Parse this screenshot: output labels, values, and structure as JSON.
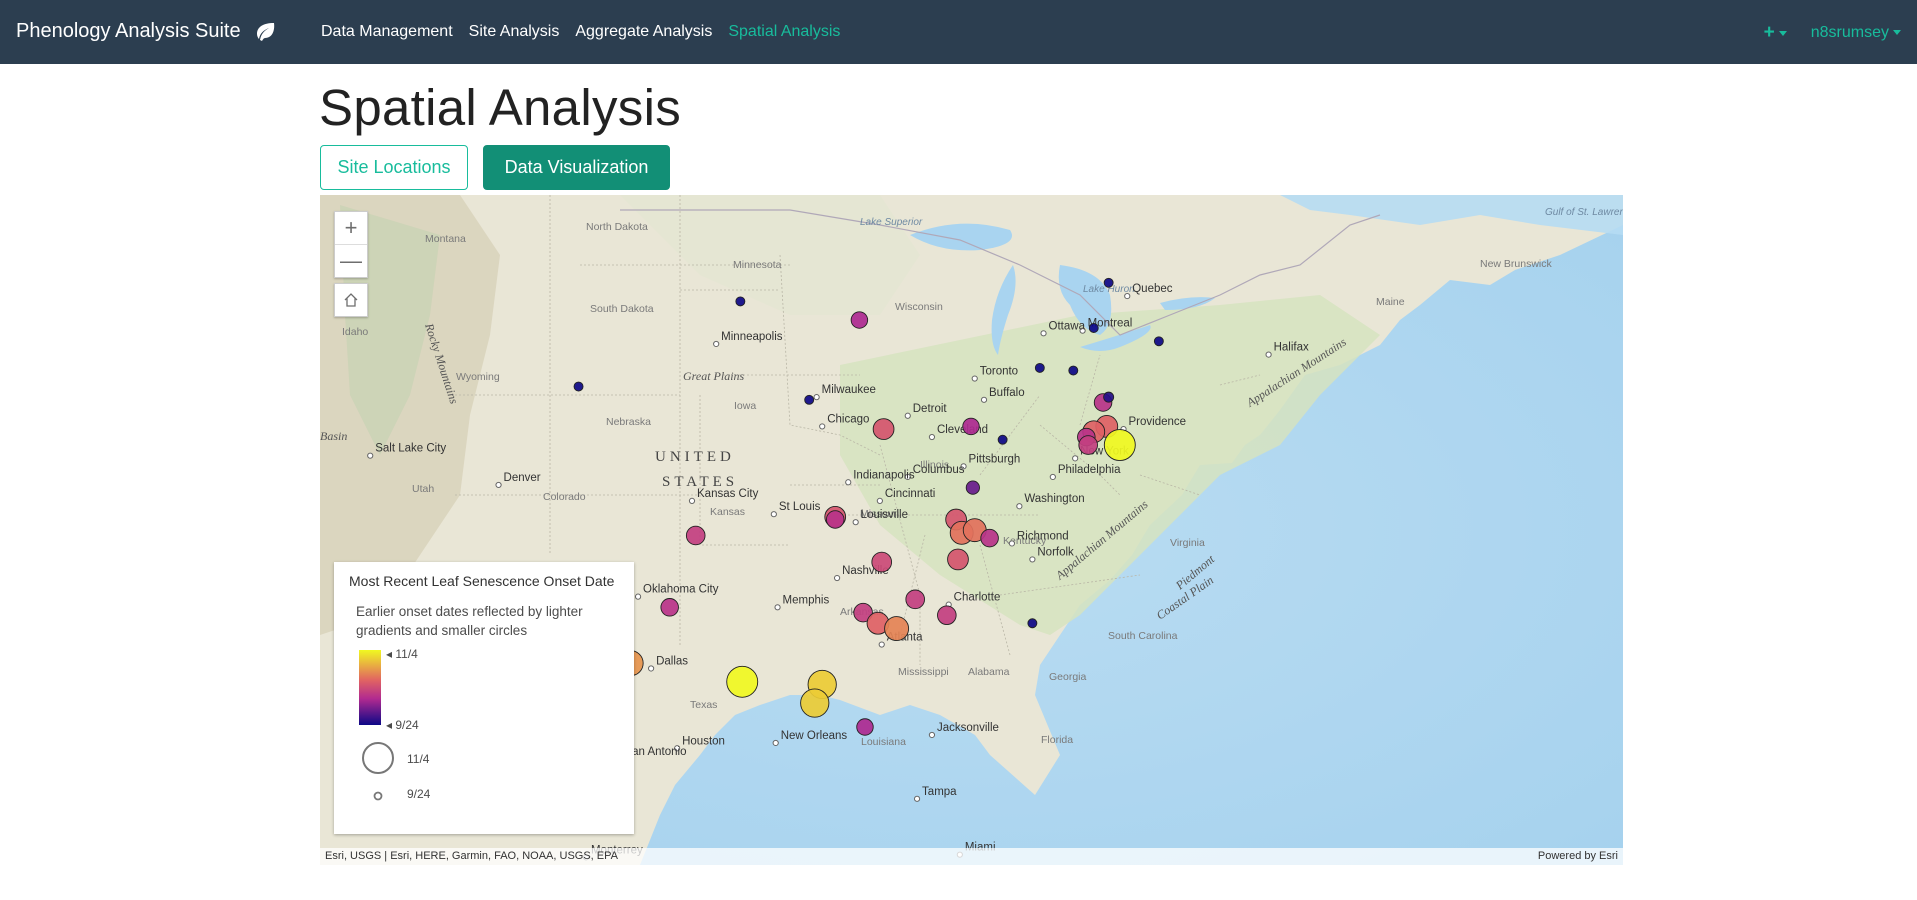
{
  "navbar": {
    "brand": "Phenology Analysis Suite",
    "brand_icon": "leaf-icon",
    "links": [
      {
        "label": "Data Management",
        "active": false
      },
      {
        "label": "Site Analysis",
        "active": false
      },
      {
        "label": "Aggregate Analysis",
        "active": false
      },
      {
        "label": "Spatial Analysis",
        "active": true
      }
    ],
    "add_label": "+",
    "user": "n8srumsey",
    "accent_color": "#18bc9c",
    "bar_color": "#2c3e50"
  },
  "page": {
    "title": "Spatial Analysis",
    "tabs": [
      {
        "label": "Site Locations",
        "selected": false
      },
      {
        "label": "Data Visualization",
        "selected": true
      }
    ]
  },
  "map": {
    "zoom_in": "+",
    "zoom_out": "—",
    "home_icon": "home-icon",
    "attribution_left": "Esri, USGS | Esri, HERE, Garmin, FAO, NOAA, USGS, EPA",
    "attribution_right": "Powered by Esri",
    "cities": [
      "Quebec",
      "Montreal",
      "Ottawa",
      "Halifax",
      "Toronto",
      "Buffalo",
      "Minneapolis",
      "Milwaukee",
      "Chicago",
      "Detroit",
      "Cleveland",
      "Pittsburgh",
      "New York",
      "Philadelphia",
      "Providence",
      "Washington",
      "Richmond",
      "Norfolk",
      "Columbus",
      "Indianapolis",
      "Cincinnati",
      "Louisville",
      "Kansas City",
      "St Louis",
      "Nashville",
      "Charlotte",
      "Atlanta",
      "Memphis",
      "Oklahoma City",
      "Dallas",
      "Houston",
      "San Antonio",
      "New Orleans",
      "Jacksonville",
      "Tampa",
      "Miami",
      "Denver",
      "Salt Lake City",
      "Monterrey"
    ],
    "regions": [
      "Montana",
      "North Dakota",
      "South Dakota",
      "Minnesota",
      "Wisconsin",
      "Iowa",
      "Nebraska",
      "Wyoming",
      "Idaho",
      "Utah",
      "Colorado",
      "Kansas",
      "Missouri",
      "Illinois",
      "Kentucky",
      "Arkansas",
      "Texas",
      "Mississippi",
      "Alabama",
      "Georgia",
      "Louisiana",
      "Florida",
      "Virginia",
      "South Carolina",
      "New Brunswick",
      "Maine",
      "Great Plains",
      "UNITED",
      "STATES",
      "Rocky Mountains",
      "Appalachian Mountains",
      "Appalachian Mountains",
      "Coastal Plain",
      "Lake Superior",
      "Lake Huron",
      "Gulf of St. Lawrence",
      "Piedmont",
      "Basin"
    ],
    "point_colors": {
      "early": "#2d0f6b",
      "mid": "#b03a7f",
      "late_mid": "#dc6a5a",
      "late": "#f2e530"
    }
  },
  "legend": {
    "title": "Most Recent Leaf Senescence Onset Date",
    "description": "Earlier onset dates reflected by lighter gradients and smaller circles",
    "color_max_label": "11/4",
    "color_min_label": "9/24",
    "size_max_label": "11/4",
    "size_min_label": "9/24"
  },
  "sites": [
    {
      "lon": -92.0,
      "lat": 46.6,
      "onset": "9/24"
    },
    {
      "lon": -85.6,
      "lat": 45.9,
      "onset": "10/8"
    },
    {
      "lon": -100.7,
      "lat": 43.4,
      "onset": "9/24"
    },
    {
      "lon": -88.3,
      "lat": 42.9,
      "onset": "9/24"
    },
    {
      "lon": -84.3,
      "lat": 41.8,
      "onset": "10/16"
    },
    {
      "lon": -79.6,
      "lat": 41.9,
      "onset": "10/8"
    },
    {
      "lon": -77.9,
      "lat": 41.4,
      "onset": "9/24"
    },
    {
      "lon": -74.1,
      "lat": 44.0,
      "onset": "9/24"
    },
    {
      "lon": -72.2,
      "lat": 47.3,
      "onset": "9/24"
    },
    {
      "lon": -73.0,
      "lat": 45.6,
      "onset": "9/24"
    },
    {
      "lon": -69.5,
      "lat": 45.1,
      "onset": "9/24"
    },
    {
      "lon": -75.9,
      "lat": 44.1,
      "onset": "9/24"
    },
    {
      "lon": -72.5,
      "lat": 42.8,
      "onset": "10/10"
    },
    {
      "lon": -72.2,
      "lat": 43.0,
      "onset": "9/26"
    },
    {
      "lon": -72.3,
      "lat": 41.9,
      "onset": "10/18"
    },
    {
      "lon": -73.0,
      "lat": 41.7,
      "onset": "10/18"
    },
    {
      "lon": -73.4,
      "lat": 41.5,
      "onset": "10/10"
    },
    {
      "lon": -71.6,
      "lat": 41.2,
      "onset": "11/4"
    },
    {
      "lon": -73.3,
      "lat": 41.2,
      "onset": "10/12"
    },
    {
      "lon": -79.5,
      "lat": 39.6,
      "onset": "10/2"
    },
    {
      "lon": -80.4,
      "lat": 38.4,
      "onset": "10/16"
    },
    {
      "lon": -80.1,
      "lat": 37.9,
      "onset": "10/20"
    },
    {
      "lon": -79.4,
      "lat": 38.0,
      "onset": "10/20"
    },
    {
      "lon": -78.6,
      "lat": 37.7,
      "onset": "10/10"
    },
    {
      "lon": -80.3,
      "lat": 36.9,
      "onset": "10/16"
    },
    {
      "lon": -86.9,
      "lat": 38.5,
      "onset": "10/16"
    },
    {
      "lon": -86.9,
      "lat": 38.4,
      "onset": "10/10"
    },
    {
      "lon": -94.4,
      "lat": 37.8,
      "onset": "10/12"
    },
    {
      "lon": -84.4,
      "lat": 36.8,
      "onset": "10/14"
    },
    {
      "lon": -82.6,
      "lat": 35.4,
      "onset": "10/12"
    },
    {
      "lon": -80.9,
      "lat": 34.8,
      "onset": "10/12"
    },
    {
      "lon": -85.4,
      "lat": 34.9,
      "onset": "10/12"
    },
    {
      "lon": -84.6,
      "lat": 34.5,
      "onset": "10/18"
    },
    {
      "lon": -83.6,
      "lat": 34.3,
      "onset": "10/22"
    },
    {
      "lon": -76.3,
      "lat": 34.5,
      "onset": "9/24"
    },
    {
      "lon": -95.8,
      "lat": 35.1,
      "onset": "10/10"
    },
    {
      "lon": -97.9,
      "lat": 33.0,
      "onset": "10/24"
    },
    {
      "lon": -91.9,
      "lat": 32.3,
      "onset": "11/4"
    },
    {
      "lon": -87.6,
      "lat": 32.2,
      "onset": "10/30"
    },
    {
      "lon": -88.0,
      "lat": 31.5,
      "onset": "10/30"
    },
    {
      "lon": -85.3,
      "lat": 30.6,
      "onset": "10/8"
    },
    {
      "lon": -98.8,
      "lat": 29.5,
      "onset": "11/4"
    }
  ]
}
